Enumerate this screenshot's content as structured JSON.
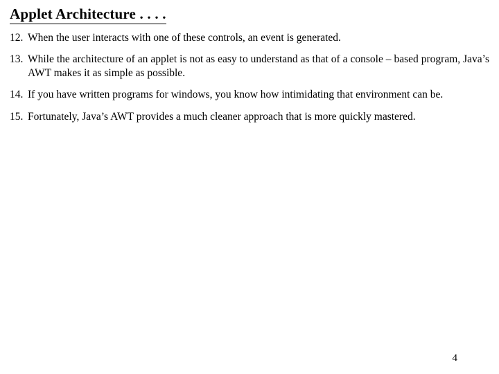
{
  "title": "Applet Architecture . . . .",
  "items": [
    {
      "num": "12.",
      "text": "When the user interacts with one of these controls, an event is generated."
    },
    {
      "num": "13.",
      "text": "While the architecture of an applet is not as easy to understand as that of a console – based program, Java’s AWT makes it as simple as possible."
    },
    {
      "num": "14.",
      "text": "If you have written programs for windows, you know how intimidating that environment can be."
    },
    {
      "num": "15.",
      "text": "Fortunately, Java’s AWT provides a much cleaner approach that is more quickly mastered."
    }
  ],
  "pageNumber": "4"
}
